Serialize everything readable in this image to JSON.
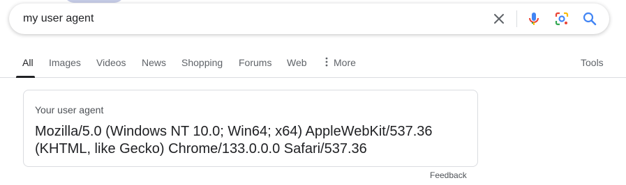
{
  "search": {
    "query": "my user agent",
    "icons": {
      "clear": "close-icon",
      "voice": "microphone-icon",
      "lens": "camera-lens-icon",
      "search": "search-icon"
    }
  },
  "tabs": [
    {
      "label": "All",
      "active": true
    },
    {
      "label": "Images"
    },
    {
      "label": "Videos"
    },
    {
      "label": "News"
    },
    {
      "label": "Shopping"
    },
    {
      "label": "Forums"
    },
    {
      "label": "Web"
    },
    {
      "label": "More",
      "icon": "more-vert-icon"
    }
  ],
  "tools_label": "Tools",
  "user_agent_card": {
    "heading": "Your user agent",
    "value": "Mozilla/5.0 (Windows NT 10.0; Win64; x64) AppleWebKit/537.36 (KHTML, like Gecko) Chrome/133.0.0.0 Safari/537.36"
  },
  "feedback_label": "Feedback",
  "colors": {
    "google_blue": "#4285F4",
    "google_red": "#EA4335",
    "google_yellow": "#FBBC05",
    "google_green": "#34A853",
    "text_primary": "#202124",
    "text_secondary": "#5f6368",
    "border": "#dadce0"
  }
}
